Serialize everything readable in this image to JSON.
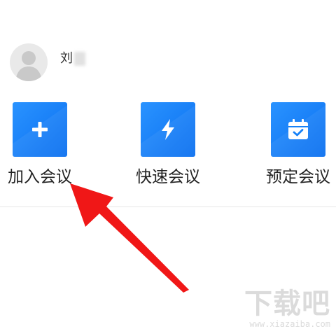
{
  "user": {
    "name": "刘"
  },
  "actions": [
    {
      "label": "加入会议",
      "icon": "plus-icon"
    },
    {
      "label": "快速会议",
      "icon": "lightning-icon"
    },
    {
      "label": "预定会议",
      "icon": "calendar-check-icon"
    }
  ],
  "colors": {
    "accent": "#1581f8",
    "annotation_arrow": "#f01717"
  },
  "watermark": {
    "brand": "下载吧",
    "url": "www.xiazaiba.com"
  }
}
